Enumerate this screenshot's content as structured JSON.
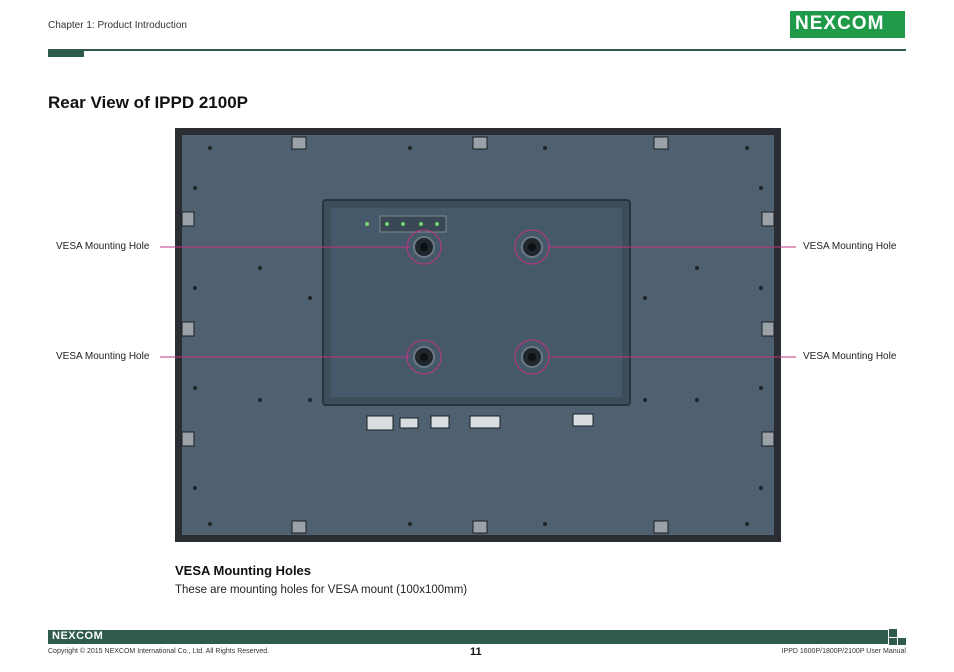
{
  "header": {
    "chapter": "Chapter 1: Product Introduction",
    "logo_text": "NEXCOM"
  },
  "page_title": "Rear View of IPPD 2100P",
  "callouts": {
    "top_left": "VESA Mounting Hole",
    "top_right": "VESA Mounting Hole",
    "bottom_left": "VESA Mounting Hole",
    "bottom_right": "VESA Mounting Hole"
  },
  "section": {
    "heading": "VESA Mounting Holes",
    "body": "These are mounting holes for VESA mount (100x100mm)"
  },
  "footer": {
    "logo_text": "NEXCOM",
    "copyright": "Copyright © 2015 NEXCOM International Co., Ltd. All Rights Reserved.",
    "page_number": "11",
    "manual_title": "IPPD 1600P/1800P/2100P User Manual"
  },
  "colors": {
    "brand_green": "#1f9a48",
    "rule_dark": "#2f5a4e",
    "panel": "#4f6070",
    "callout_line": "#c0337f"
  }
}
